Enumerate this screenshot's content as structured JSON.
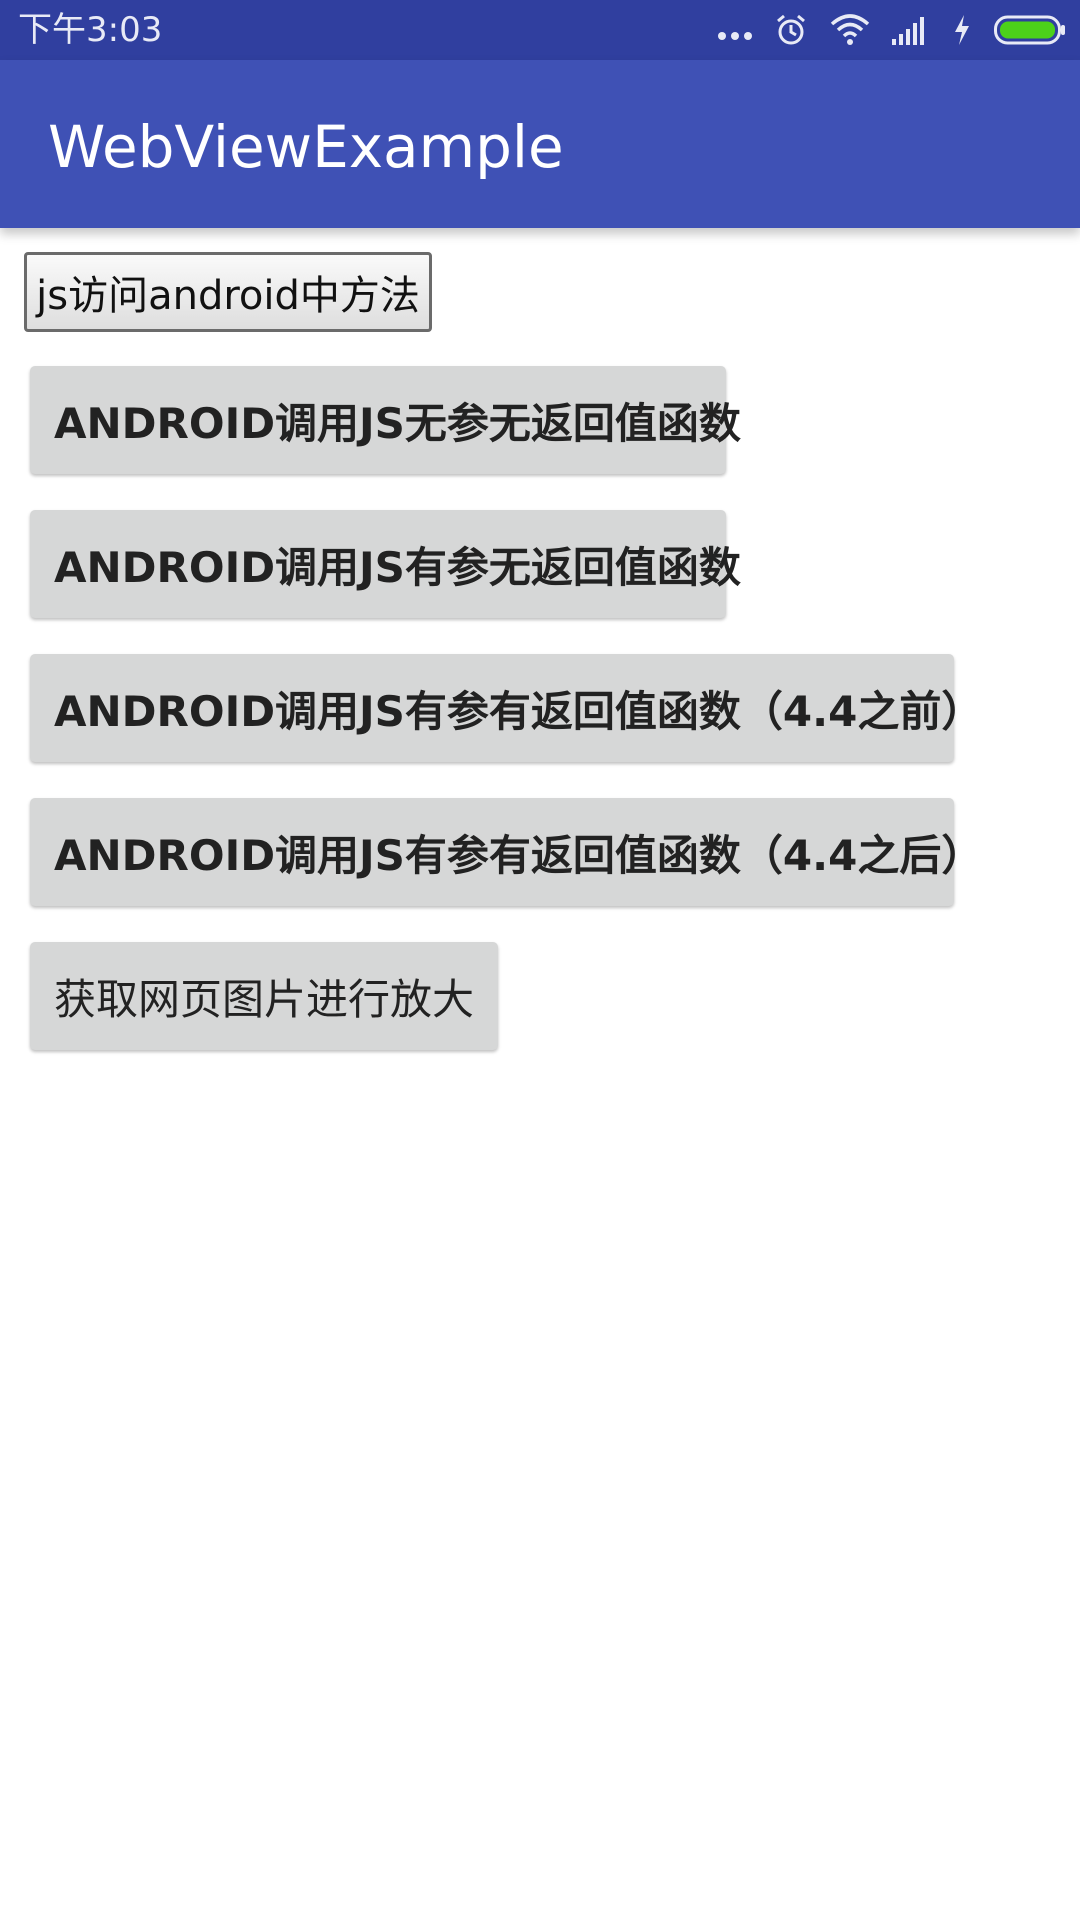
{
  "status_bar": {
    "time": "下午3:03",
    "icons": [
      "more-dots-icon",
      "alarm-icon",
      "wifi-icon",
      "signal-icon",
      "charging-icon",
      "battery-icon"
    ],
    "colors": {
      "background": "#303f9f",
      "battery_fill": "#4cd11a"
    }
  },
  "app_bar": {
    "title": "WebViewExample",
    "color": "#3f51b5"
  },
  "webview": {
    "button_label": "js访问android中方法"
  },
  "buttons": [
    {
      "label": "ANDROID调用JS无参无返回值函数"
    },
    {
      "label": "ANDROID调用JS有参无返回值函数"
    },
    {
      "label": "ANDROID调用JS有参有返回值函数（4.4之前）"
    },
    {
      "label": "ANDROID调用JS有参有返回值函数（4.4之后）"
    },
    {
      "label": "获取网页图片进行放大"
    }
  ]
}
